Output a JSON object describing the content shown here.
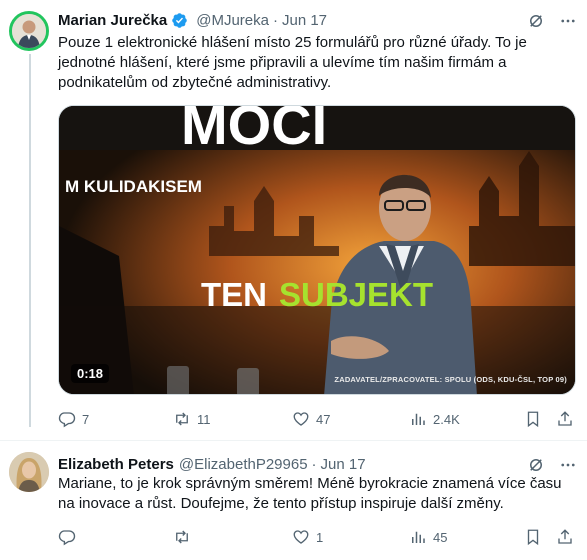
{
  "tweet": {
    "author_name": "Marian Jurečka",
    "handle": "@MJureka",
    "separator": "·",
    "date": "Jun 17",
    "text": "Pouze 1 elektronické hlášení místo 25 formulářů pro různé úřady. To je jednotné hlášení, které jsme připravili a ulevíme tím našim firmám a podnikatelům od zbytečné administrativy.",
    "media": {
      "headline_text": "MOCI",
      "subheadline_text": "M KULIDAKISEM",
      "caption_white": "TEN",
      "caption_green": "SUBJEKT",
      "duration": "0:18",
      "credit": "ZADAVATEL/ZPRACOVATEL: SPOLU (ODS, KDU-ČSL, TOP 09)"
    },
    "stats": {
      "replies": "7",
      "reposts": "11",
      "likes": "47",
      "views": "2.4K"
    },
    "colors": {
      "verified": "#1d9bf0",
      "avatar_ring": "#22c55e",
      "caption_green": "#a6e22e"
    }
  },
  "reply": {
    "author_name": "Elizabeth Peters",
    "handle": "@ElizabethP29965",
    "separator": "·",
    "date": "Jun 17",
    "text": "Mariane, to je krok správným směrem! Méně byrokracie znamená více času na inovace a růst. Doufejme, že tento přístup inspiruje další změny.",
    "stats": {
      "replies": "",
      "reposts": "",
      "likes": "1",
      "views": "45"
    }
  }
}
